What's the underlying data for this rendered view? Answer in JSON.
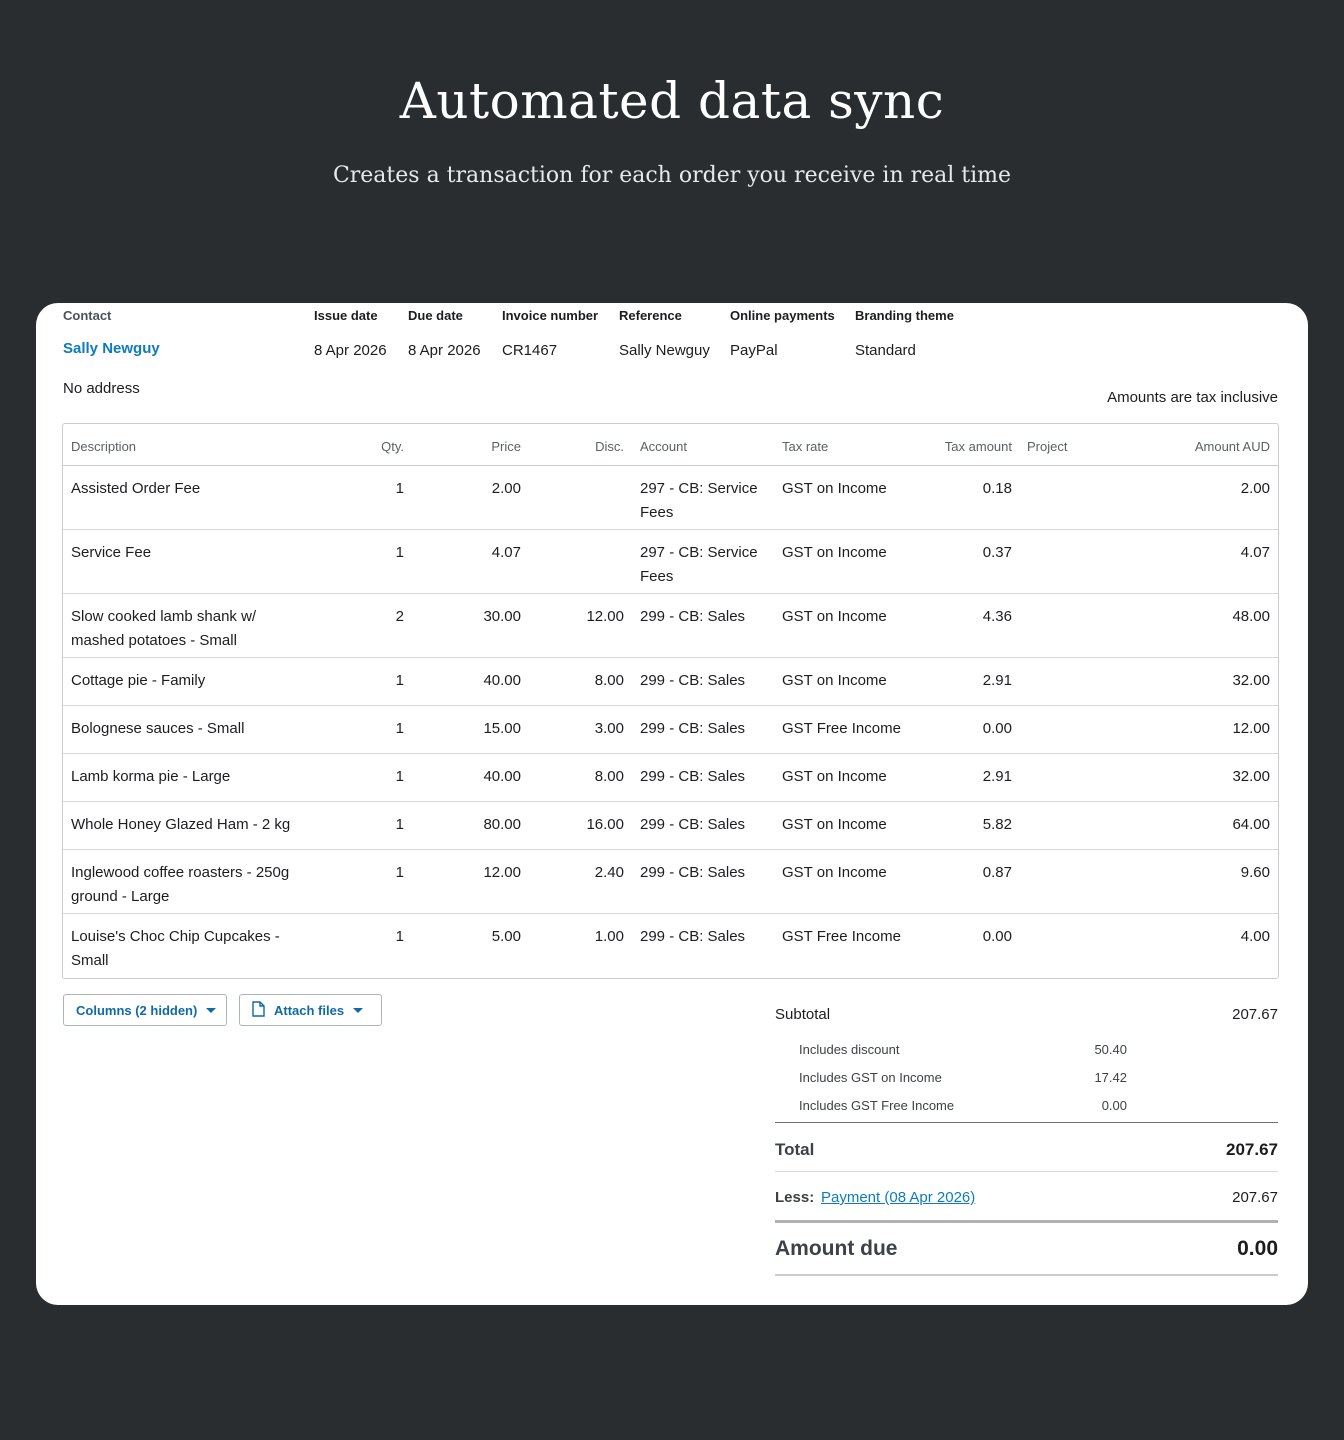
{
  "hero": {
    "title": "Automated data sync",
    "subtitle": "Creates a transaction for each order you receive in real time"
  },
  "invoice": {
    "labels": {
      "contact": "Contact",
      "issue_date": "Issue date",
      "due_date": "Due date",
      "invoice_number": "Invoice number",
      "reference": "Reference",
      "online_payments": "Online payments",
      "branding_theme": "Branding theme"
    },
    "contact_name": "Sally Newguy",
    "issue_date": "8 Apr 2026",
    "due_date": "8 Apr 2026",
    "invoice_number": "CR1467",
    "reference": "Sally Newguy",
    "online_payments": "PayPal",
    "branding_theme": "Standard",
    "address": "No address",
    "tax_note": "Amounts are tax inclusive"
  },
  "table": {
    "headers": {
      "description": "Description",
      "qty": "Qty.",
      "price": "Price",
      "disc": "Disc.",
      "account": "Account",
      "tax_rate": "Tax rate",
      "tax_amount": "Tax amount",
      "project": "Project",
      "amount": "Amount AUD"
    },
    "rows": [
      {
        "desc_1": "Assisted Order Fee",
        "desc_2": "",
        "qty": "1",
        "price": "2.00",
        "disc": "",
        "acct_1": "297 - CB: Service",
        "acct_2": "Fees",
        "tax_rate": "GST on Income",
        "tax_amount": "0.18",
        "amount": "2.00"
      },
      {
        "desc_1": "Service Fee",
        "desc_2": "",
        "qty": "1",
        "price": "4.07",
        "disc": "",
        "acct_1": "297 - CB: Service",
        "acct_2": "Fees",
        "tax_rate": "GST on Income",
        "tax_amount": "0.37",
        "amount": "4.07"
      },
      {
        "desc_1": "Slow cooked lamb shank w/",
        "desc_2": "mashed potatoes - Small",
        "qty": "2",
        "price": "30.00",
        "disc": "12.00",
        "acct_1": "299 - CB: Sales",
        "acct_2": "",
        "tax_rate": "GST on Income",
        "tax_amount": "4.36",
        "amount": "48.00"
      },
      {
        "desc_1": "Cottage pie - Family",
        "desc_2": "",
        "qty": "1",
        "price": "40.00",
        "disc": "8.00",
        "acct_1": "299 - CB: Sales",
        "acct_2": "",
        "tax_rate": "GST on Income",
        "tax_amount": "2.91",
        "amount": "32.00"
      },
      {
        "desc_1": "Bolognese sauces - Small",
        "desc_2": "",
        "qty": "1",
        "price": "15.00",
        "disc": "3.00",
        "acct_1": "299 - CB: Sales",
        "acct_2": "",
        "tax_rate": "GST Free Income",
        "tax_amount": "0.00",
        "amount": "12.00"
      },
      {
        "desc_1": "Lamb korma pie - Large",
        "desc_2": "",
        "qty": "1",
        "price": "40.00",
        "disc": "8.00",
        "acct_1": "299 - CB: Sales",
        "acct_2": "",
        "tax_rate": "GST on Income",
        "tax_amount": "2.91",
        "amount": "32.00"
      },
      {
        "desc_1": "Whole Honey Glazed Ham - 2 kg",
        "desc_2": "",
        "qty": "1",
        "price": "80.00",
        "disc": "16.00",
        "acct_1": "299 - CB: Sales",
        "acct_2": "",
        "tax_rate": "GST on Income",
        "tax_amount": "5.82",
        "amount": "64.00"
      },
      {
        "desc_1": "Inglewood coffee roasters - 250g",
        "desc_2": "ground - Large",
        "qty": "1",
        "price": "12.00",
        "disc": "2.40",
        "acct_1": "299 - CB: Sales",
        "acct_2": "",
        "tax_rate": "GST on Income",
        "tax_amount": "0.87",
        "amount": "9.60"
      },
      {
        "desc_1": "Louise's Choc Chip Cupcakes -",
        "desc_2": "Small",
        "qty": "1",
        "price": "5.00",
        "disc": "1.00",
        "acct_1": "299 - CB: Sales",
        "acct_2": "",
        "tax_rate": "GST Free Income",
        "tax_amount": "0.00",
        "amount": "4.00"
      }
    ]
  },
  "buttons": {
    "columns": "Columns (2 hidden)",
    "attach": "Attach files"
  },
  "totals": {
    "subtotal_label": "Subtotal",
    "subtotal": "207.67",
    "discount_label": "Includes discount",
    "discount": "50.40",
    "gst_label": "Includes GST on Income",
    "gst": "17.42",
    "gst_free_label": "Includes GST Free Income",
    "gst_free": "0.00",
    "total_label": "Total",
    "total": "207.67",
    "less_label": "Less:",
    "payment_label": "Payment (08 Apr 2026)",
    "payment": "207.67",
    "amount_due_label": "Amount due",
    "amount_due": "0.00"
  },
  "colors": {
    "page_bg": "#2a2d30",
    "card_bg": "#ffffff",
    "link": "#0f7bbf",
    "border": "#c9cdd1"
  }
}
